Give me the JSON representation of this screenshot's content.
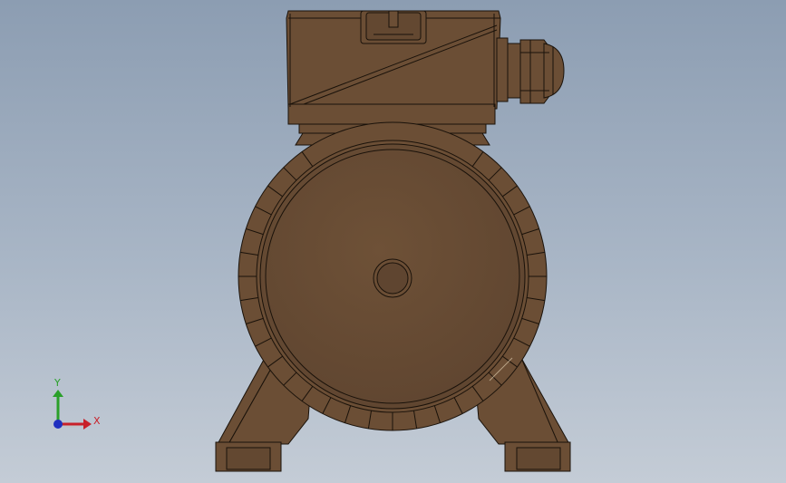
{
  "viewport": {
    "background_top": "#8c9db2",
    "background_bottom": "#c4ccd6"
  },
  "model": {
    "body_color": "#6b4e35",
    "edge_color": "#1a120a",
    "highlight_color": "#7d5c40"
  },
  "triad": {
    "x_label": "X",
    "y_label": "Y",
    "x_color": "#c8202a",
    "y_color": "#2aa02a",
    "z_color": "#2030c0"
  }
}
